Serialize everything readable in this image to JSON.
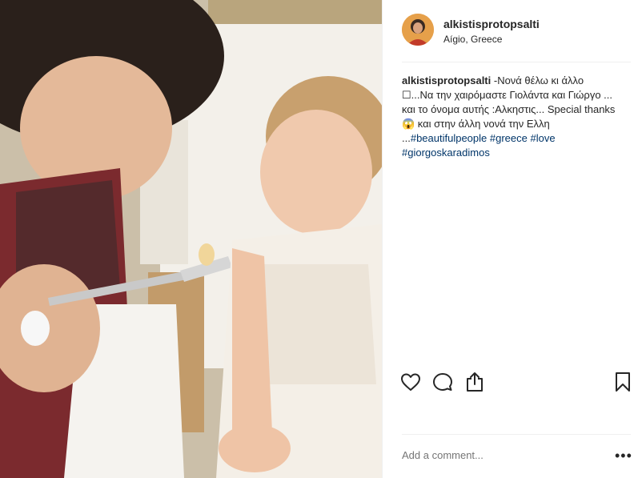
{
  "post": {
    "username": "alkistisprotopsalti",
    "location": "Aígio, Greece"
  },
  "caption": {
    "username": "alkistisprotopsalti",
    "text": " -Νονά θέλω κι άλλο ☐...Να την χαιρόμαστε Γιολάντα και Γιώργο ... και το όνομα αυτής :Αλκηστις... Special thanks 😱 και στην άλλη νονά την Ελλη ...",
    "hashtags": [
      "#beautifulpeople",
      "#greece",
      "#love",
      "#giorgoskaradimos"
    ]
  },
  "comment": {
    "placeholder": "Add a comment..."
  },
  "more_label": "•••",
  "icons": {
    "like": "heart-icon",
    "comment": "comment-icon",
    "share": "share-icon",
    "save": "bookmark-icon",
    "more": "more-icon"
  },
  "colors": {
    "text": "#262626",
    "hashtag": "#003569",
    "placeholder": "#999999",
    "divider": "#efefef"
  }
}
